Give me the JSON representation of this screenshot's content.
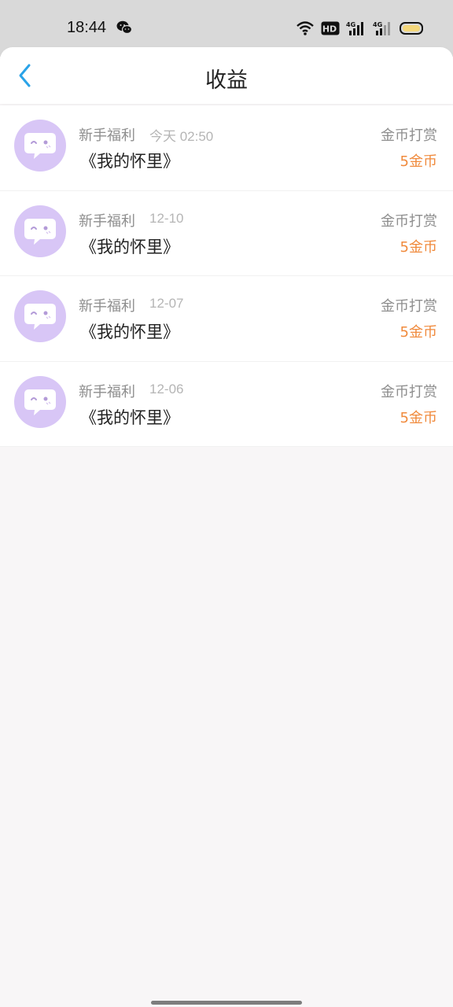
{
  "status_bar": {
    "time": "18:44",
    "icons": [
      "wechat-icon",
      "wifi-icon",
      "hd-icon",
      "signal-4g-icon",
      "signal-4g-icon",
      "battery-icon"
    ],
    "hd_text": "HD",
    "net_text_1": "4G",
    "net_text_2": "4G"
  },
  "header": {
    "title": "收益",
    "back_icon": "chevron-left-icon"
  },
  "colors": {
    "accent_orange": "#f08a3c",
    "back_blue": "#2aa3e8",
    "avatar_purple": "#d8c6f6"
  },
  "items": [
    {
      "source": "新手福利",
      "date": "今天 02:50",
      "book": "《我的怀里》",
      "reward_type": "金币打赏",
      "amount": "5金币"
    },
    {
      "source": "新手福利",
      "date": "12-10",
      "book": "《我的怀里》",
      "reward_type": "金币打赏",
      "amount": "5金币"
    },
    {
      "source": "新手福利",
      "date": "12-07",
      "book": "《我的怀里》",
      "reward_type": "金币打赏",
      "amount": "5金币"
    },
    {
      "source": "新手福利",
      "date": "12-06",
      "book": "《我的怀里》",
      "reward_type": "金币打赏",
      "amount": "5金币"
    }
  ]
}
